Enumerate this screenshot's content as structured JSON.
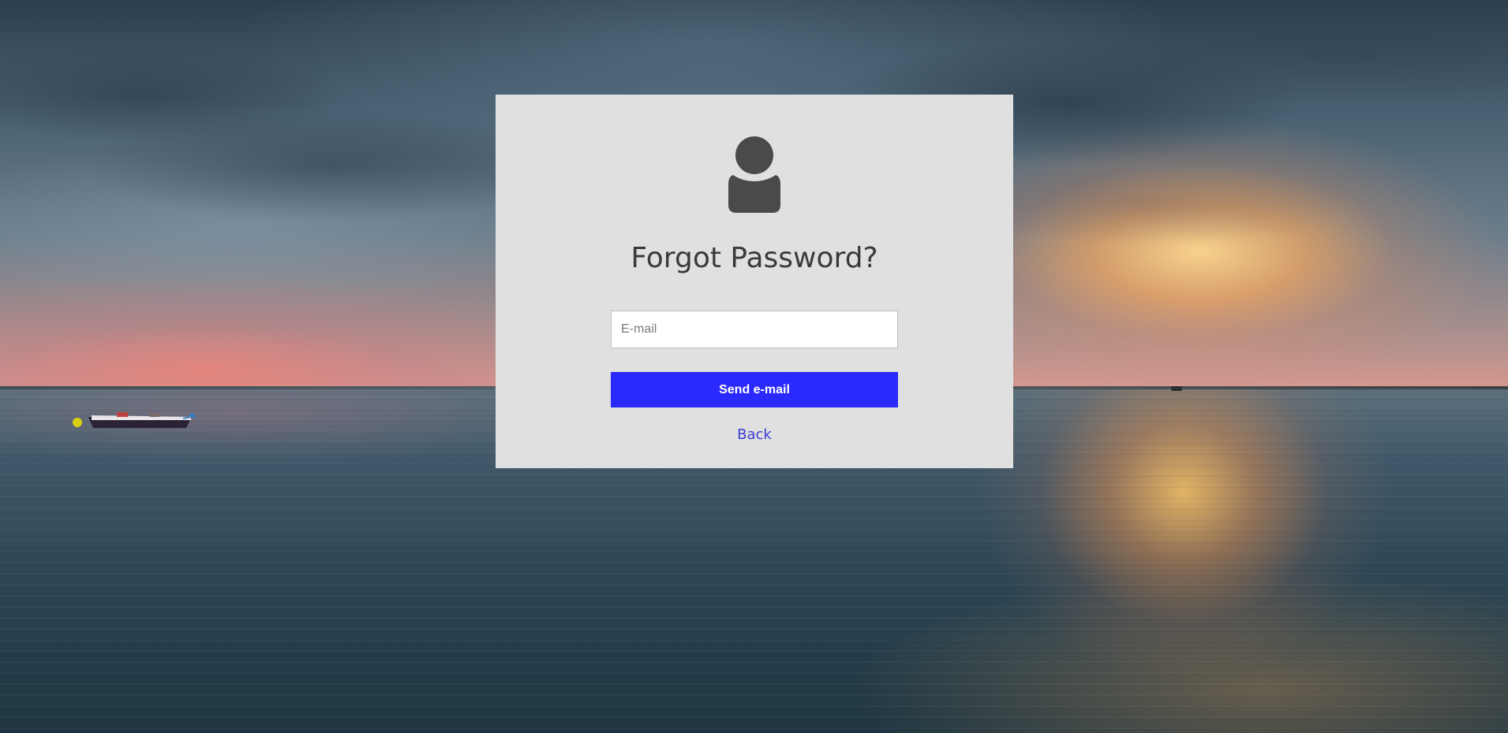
{
  "background": {
    "description_icon": "sunset-sea-background"
  },
  "card": {
    "icon": "user-icon",
    "title": "Forgot Password?",
    "email": {
      "placeholder": "E-mail",
      "value": ""
    },
    "send_label": "Send e-mail",
    "back_label": "Back"
  },
  "colors": {
    "card_bg": "#e0e0e0",
    "accent": "#2a2aff",
    "link": "#3b3bd1",
    "icon": "#4a4a4a",
    "title": "#3a3a3a"
  }
}
